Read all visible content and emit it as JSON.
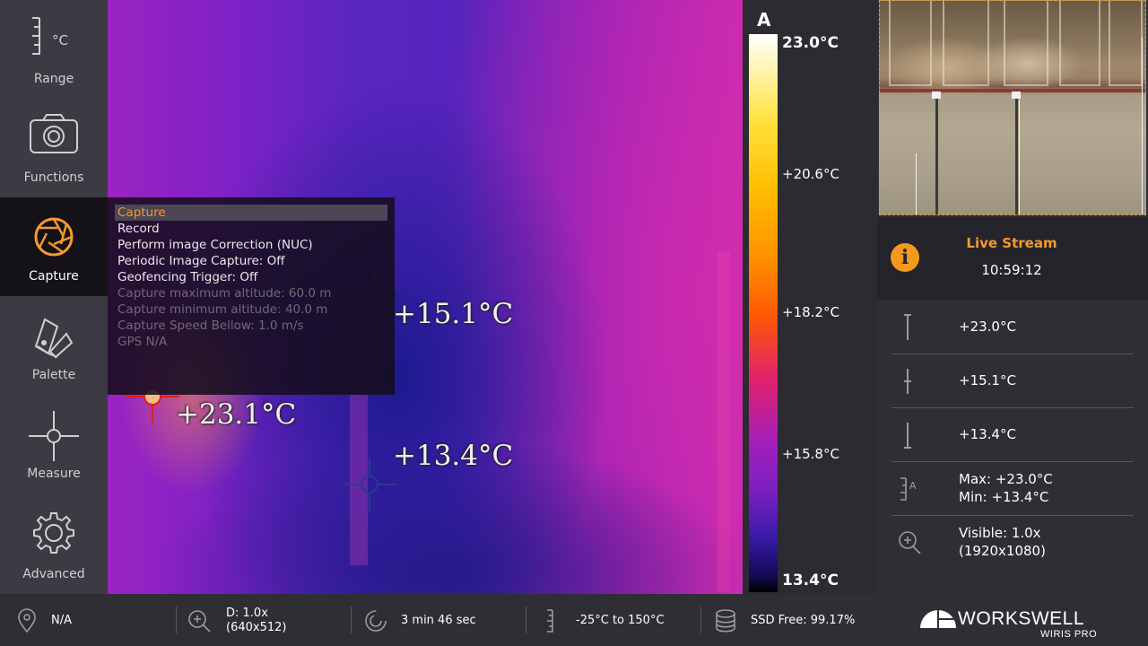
{
  "sidebar": {
    "items": [
      {
        "label": "Range",
        "icon": "range-scale-celsius-icon",
        "unit": "°C"
      },
      {
        "label": "Functions",
        "icon": "camera-icon"
      },
      {
        "label": "Capture",
        "icon": "aperture-icon",
        "active": true
      },
      {
        "label": "Palette",
        "icon": "palette-swatch-icon"
      },
      {
        "label": "Measure",
        "icon": "crosshair-icon"
      },
      {
        "label": "Advanced",
        "icon": "gear-icon"
      }
    ]
  },
  "capture_menu": {
    "items": [
      {
        "label": "Capture",
        "selected": true,
        "enabled": true
      },
      {
        "label": "Record",
        "enabled": true
      },
      {
        "label": "Perform image Correction (NUC)",
        "enabled": true
      },
      {
        "label": "Periodic Image Capture: Off",
        "enabled": true
      },
      {
        "label": "Geofencing Trigger: Off",
        "enabled": true
      },
      {
        "label": "Capture maximum altitude: 60.0 m",
        "enabled": false
      },
      {
        "label": "Capture minimum altitude: 40.0 m",
        "enabled": false
      },
      {
        "label": "Capture Speed Bellow: 1.0 m/s",
        "enabled": false
      },
      {
        "label": "GPS N/A",
        "enabled": false
      }
    ]
  },
  "thermal": {
    "markers": [
      {
        "name": "hot-spot",
        "label": "+23.1°C",
        "color": "#e01e1e"
      },
      {
        "name": "center-spot",
        "label": "+15.1°C",
        "color": "#1f1f1f"
      },
      {
        "name": "cold-spot",
        "label": "+13.4°C",
        "color": "#2b3a8c"
      }
    ]
  },
  "scale": {
    "mode_letter": "A",
    "labels": [
      "23.0°C",
      "+20.6°C",
      "+18.2°C",
      "+15.8°C",
      "13.4°C"
    ]
  },
  "right_panel": {
    "live_title": "Live Stream",
    "live_time": "10:59:12",
    "stats": [
      {
        "icon": "max-temp-icon",
        "lines": [
          "+23.0°C"
        ]
      },
      {
        "icon": "center-temp-icon",
        "lines": [
          "+15.1°C"
        ]
      },
      {
        "icon": "min-temp-icon",
        "lines": [
          "+13.4°C"
        ]
      },
      {
        "icon": "auto-range-icon",
        "lines": [
          "Max: +23.0°C",
          "Min: +13.4°C"
        ]
      },
      {
        "icon": "zoom-icon",
        "lines": [
          "Visible: 1.0x",
          "(1920x1080)"
        ]
      }
    ],
    "brand_name": "WORKSWELL",
    "brand_sub": "WIRIS PRO"
  },
  "bottom_bar": {
    "gps": "N/A",
    "digital_zoom_line1": "D: 1.0x",
    "digital_zoom_line2": "(640x512)",
    "recording_time": "3 min 46 sec",
    "temp_range": "-25°C to 150°C",
    "ssd_free": "SSD Free: 99.17%"
  },
  "colors": {
    "accent": "#f39a2e",
    "sidebar_bg": "#3c3a42",
    "panel_bg": "#2f2e35"
  }
}
